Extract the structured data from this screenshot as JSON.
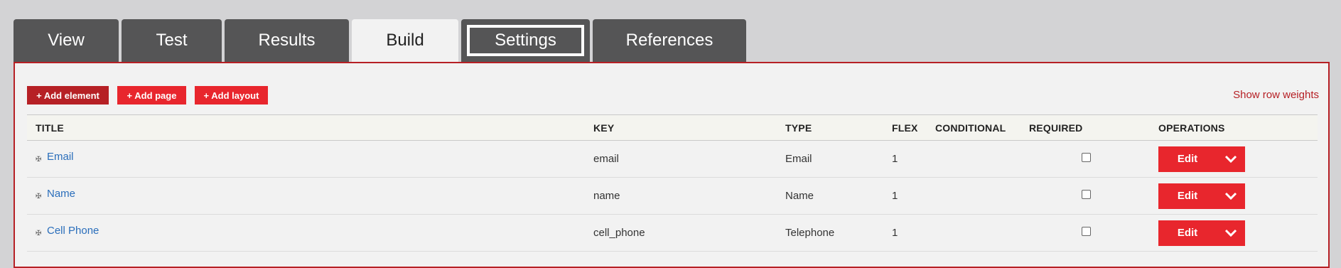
{
  "tabs": [
    {
      "label": "View"
    },
    {
      "label": "Test"
    },
    {
      "label": "Results"
    },
    {
      "label": "Build"
    },
    {
      "label": "Settings"
    },
    {
      "label": "References"
    }
  ],
  "actions": {
    "add_element": "+ Add element",
    "add_page": "+ Add page",
    "add_layout": "+ Add layout",
    "row_weights": "Show row weights"
  },
  "table": {
    "headers": {
      "title": "TITLE",
      "key": "KEY",
      "type": "TYPE",
      "flex": "FLEX",
      "conditional": "CONDITIONAL",
      "required": "REQUIRED",
      "operations": "OPERATIONS"
    },
    "rows": [
      {
        "title": "Email",
        "key": "email",
        "type": "Email",
        "flex": "1",
        "edit": "Edit"
      },
      {
        "title": "Name",
        "key": "name",
        "type": "Name",
        "flex": "1",
        "edit": "Edit"
      },
      {
        "title": "Cell Phone",
        "key": "cell_phone",
        "type": "Telephone",
        "flex": "1",
        "edit": "Edit"
      }
    ]
  },
  "colors": {
    "accent": "#e8262d",
    "accent_dark": "#b62025",
    "tab_bg": "#555556",
    "link": "#2a6ebb"
  }
}
